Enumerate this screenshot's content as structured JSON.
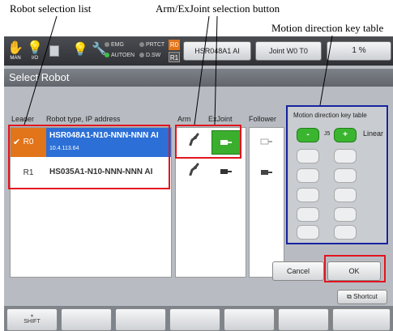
{
  "callouts": {
    "robot_list": "Robot selection list",
    "arm_exjoint": "Arm/ExJoint selection button",
    "motion_keys": "Motion direction key table"
  },
  "topbar": {
    "mode_label": "MAN",
    "io_label": "I/O",
    "indicators": [
      {
        "label": "EMG",
        "state": "off"
      },
      {
        "label": "PRTCT",
        "state": "off"
      },
      {
        "label": "AUTOEN",
        "state": "on"
      },
      {
        "label": "D.SW",
        "state": "off"
      }
    ],
    "robot_tags": [
      "R0",
      "R1"
    ],
    "robot_button": "HSR048A1 AI",
    "coord_button": "Joint W0 T0",
    "speed_readout": "1 %"
  },
  "dialog": {
    "title": "Select Robot",
    "headers": {
      "leader": "Leader",
      "type_ip": "Robot type, IP address",
      "arm": "Arm",
      "exjoint": "ExJoint",
      "follower": "Follower"
    },
    "robots": [
      {
        "leader": "R0",
        "type": "HSR048A1-N10-NNN-NNN AI",
        "ip": "10.4.113.64",
        "selected": true,
        "arm_icon": "robot-arm-icon",
        "exjoint_icon": "exjoint-icon",
        "exjoint_active": true,
        "follower_icon": "follower-icon"
      },
      {
        "leader": "R1",
        "type": "HS035A1-N10-NNN-NNN AI",
        "ip": "",
        "selected": false,
        "arm_icon": "robot-arm-icon",
        "exjoint_icon": "exjoint-icon",
        "exjoint_active": false,
        "follower_icon": "follower-icon"
      }
    ],
    "keys": {
      "title": "Motion direction key table",
      "minus": "-",
      "plus": "+",
      "axis": "J5",
      "mode": "Linear"
    },
    "cancel_label": "Cancel",
    "ok_label": "OK"
  },
  "shortcut_label": "Shortcut",
  "fkeys": [
    {
      "label": "SHIFT"
    },
    {
      "label": ""
    },
    {
      "label": ""
    },
    {
      "label": ""
    },
    {
      "label": ""
    },
    {
      "label": ""
    },
    {
      "label": ""
    }
  ],
  "colors": {
    "annotation_red": "#e2141f",
    "annotation_blue": "#16249e",
    "selected_row": "#2c6fd6",
    "leader_badge": "#e2741a",
    "active_green": "#3cae2e"
  }
}
